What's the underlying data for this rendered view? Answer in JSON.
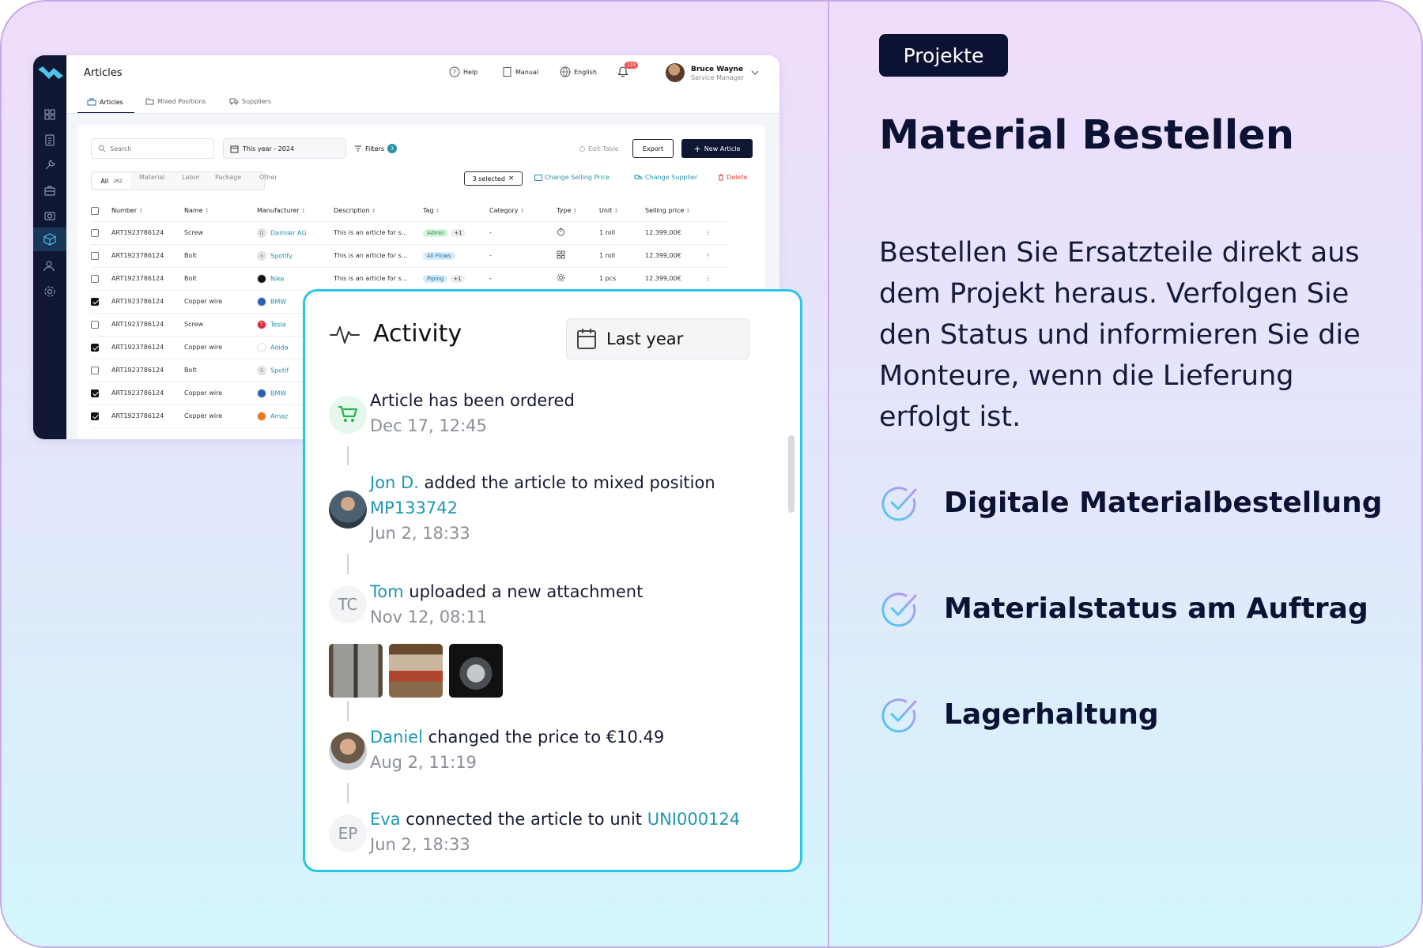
{
  "right": {
    "tag": "Projekte",
    "headline": "Material Bestellen",
    "intro": "Bestellen Sie Ersatzteile direkt aus dem Projekt heraus. Verfolgen Sie den Status und informieren Sie die Monteure, wenn die Lieferung erfolgt ist.",
    "features": [
      "Digitale Materialbestellung",
      "Materialstatus am Auftrag",
      "Lagerhaltung"
    ],
    "accent": "#b48ef0"
  },
  "app": {
    "title": "Articles",
    "header": {
      "help": "Help",
      "manual": "Manual",
      "language": "English",
      "notifications": "123"
    },
    "user": {
      "name": "Bruce Wayne",
      "role": "Service Manager"
    },
    "tabs": [
      "Articles",
      "Mixed Positions",
      "Suppliers"
    ],
    "search_placeholder": "Search",
    "date_filter": "This year - 2024",
    "filters": {
      "label": "Filters",
      "count": "3"
    },
    "edit_table": "Edit Table",
    "export": "Export",
    "new_article": "New Article",
    "filter_tabs": {
      "all": "All",
      "all_count": "262",
      "items": [
        "Material",
        "Labor",
        "Package",
        "Other"
      ]
    },
    "selection": {
      "selected": "3 selected",
      "change_price": "Change Selling Price",
      "change_supplier": "Change Supplier",
      "delete": "Delete"
    },
    "columns": [
      "Number",
      "Name",
      "Manufacturer",
      "Description",
      "Tag",
      "Category",
      "Type",
      "Unit",
      "Selling price"
    ],
    "rows": [
      {
        "number": "ART1923786124",
        "name": "Screw",
        "manufacturer": "Daimler AG",
        "mfr_icon": "D",
        "mfr_color": "#e4e6ea",
        "description": "This is an article for s...",
        "tag": "Admin",
        "tag_plus": "+1",
        "tag_bg": "#d5f5dc",
        "tag_fg": "#1f8a3a",
        "category": "-",
        "type_icon": "timer-icon",
        "unit": "1 roll",
        "price": "12.399,00€",
        "checked": false
      },
      {
        "number": "ART1923786124",
        "name": "Bolt",
        "manufacturer": "Spotify",
        "mfr_icon": "S",
        "mfr_color": "#e4e6ea",
        "description": "This is an article for s...",
        "tag": "All Flows",
        "tag_plus": "",
        "tag_bg": "#d6ecfb",
        "tag_fg": "#1a6fa8",
        "category": "-",
        "type_icon": "grid-icon",
        "unit": "1 roll",
        "price": "12.399,00€",
        "checked": false
      },
      {
        "number": "ART1923786124",
        "name": "Bolt",
        "manufacturer": "Nike",
        "mfr_icon": "",
        "mfr_color": "#111111",
        "description": "This is an article for s...",
        "tag": "Piping",
        "tag_plus": "+1",
        "tag_bg": "#d6ecfb",
        "tag_fg": "#1a6fa8",
        "category": "-",
        "type_icon": "gear-icon",
        "unit": "1 pcs",
        "price": "12.399,00€",
        "checked": false
      },
      {
        "number": "ART1923786124",
        "name": "Copper wire",
        "manufacturer": "BMW",
        "mfr_icon": "",
        "mfr_color": "#2a5fb5",
        "checked": true
      },
      {
        "number": "ART1923786124",
        "name": "Screw",
        "manufacturer": "Tesla",
        "mfr_icon": "T",
        "mfr_color": "#e0283a",
        "checked": false
      },
      {
        "number": "ART1923786124",
        "name": "Copper wire",
        "manufacturer": "Adida",
        "mfr_icon": "",
        "mfr_color": "#ffffff",
        "checked": true
      },
      {
        "number": "ART1923786124",
        "name": "Bolt",
        "manufacturer": "Spotif",
        "mfr_icon": "S",
        "mfr_color": "#e4e6ea",
        "checked": false
      },
      {
        "number": "ART1923786124",
        "name": "Copper wire",
        "manufacturer": "BMW",
        "mfr_icon": "",
        "mfr_color": "#2a5fb5",
        "checked": true
      },
      {
        "number": "ART1923786124",
        "name": "Copper wire",
        "manufacturer": "Amaz",
        "mfr_icon": "",
        "mfr_color": "#f07a1a",
        "checked": true
      }
    ]
  },
  "activity": {
    "title": "Activity",
    "filter": "Last year",
    "items": [
      {
        "actor": "",
        "text": "Article has been ordered",
        "link": "",
        "time": "Dec 17, 12:45"
      },
      {
        "actor": "Jon D.",
        "text": " added the article to mixed position ",
        "link": "MP133742",
        "time": "Jun 2, 18:33"
      },
      {
        "actor": "Tom",
        "initials": "TC",
        "text": " uploaded a new attachment",
        "link": "",
        "time": "Nov 12, 08:11"
      },
      {
        "actor": "Daniel",
        "text": " changed the price to €10.49",
        "link": "",
        "time": "Aug 2, 11:19"
      },
      {
        "actor": "Eva",
        "initials": "EP",
        "text": " connected the article to unit ",
        "link": "UNI000124",
        "time": "Jun 2, 18:33"
      }
    ]
  }
}
